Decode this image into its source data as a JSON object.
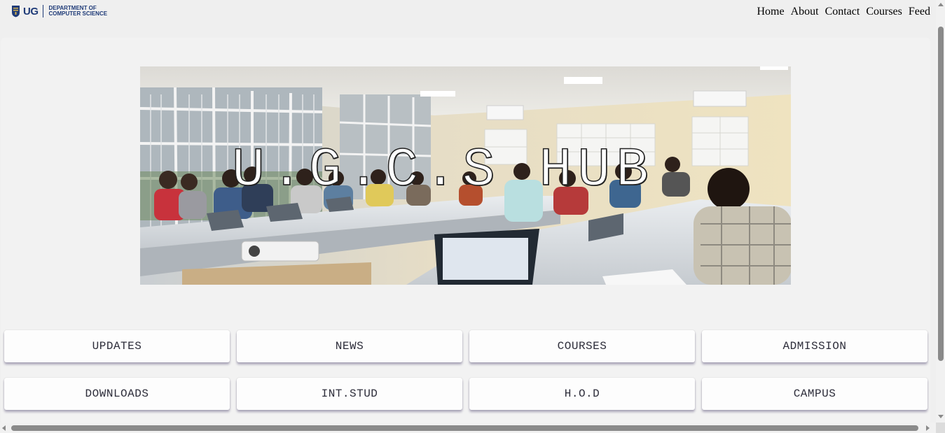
{
  "header": {
    "logo": {
      "short": "UG",
      "line1": "DEPARTMENT OF",
      "line2": "COMPUTER SCIENCE"
    },
    "nav": [
      {
        "label": "Home"
      },
      {
        "label": "About"
      },
      {
        "label": "Contact"
      },
      {
        "label": "Courses"
      },
      {
        "label": "Feed"
      }
    ]
  },
  "hero": {
    "title": "U.G.C.S HUB",
    "image": "classroom-photo"
  },
  "tiles": [
    {
      "label": "UPDATES"
    },
    {
      "label": "NEWS"
    },
    {
      "label": "COURSES"
    },
    {
      "label": "ADMISSION"
    },
    {
      "label": "DOWNLOADS"
    },
    {
      "label": "INT.STUD"
    },
    {
      "label": "H.O.D"
    },
    {
      "label": "CAMPUS"
    }
  ],
  "colors": {
    "brand": "#1f3b78",
    "background": "#efefef",
    "tile": "#fdfdfd"
  }
}
